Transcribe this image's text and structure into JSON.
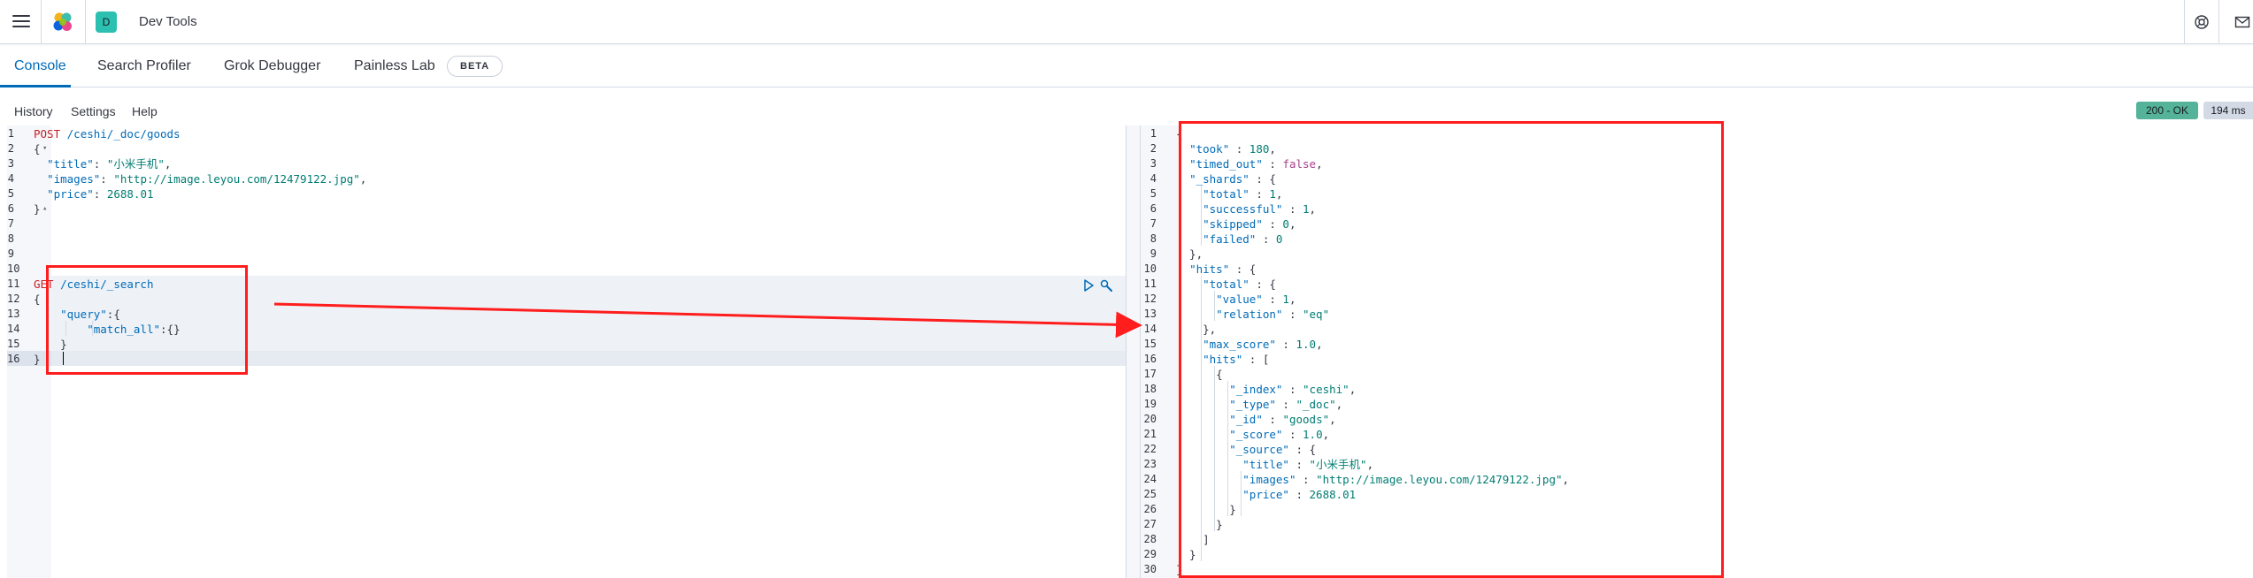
{
  "header": {
    "space_initial": "D",
    "app_title": "Dev Tools"
  },
  "tabs": [
    {
      "label": "Console",
      "active": true
    },
    {
      "label": "Search Profiler",
      "active": false
    },
    {
      "label": "Grok Debugger",
      "active": false
    },
    {
      "label": "Painless Lab",
      "active": false
    }
  ],
  "beta_badge": "BETA",
  "toolbar": {
    "history": "History",
    "settings": "Settings",
    "help": "Help"
  },
  "response_status": "200 - OK",
  "response_time": "194 ms",
  "request_editor": {
    "lines": [
      [
        [
          "m",
          "POST"
        ],
        [
          "",
          " "
        ],
        [
          "u",
          "/ceshi/_doc/goods"
        ]
      ],
      [
        [
          "",
          "{"
        ]
      ],
      [
        [
          "",
          "  "
        ],
        [
          "k",
          "\"title\""
        ],
        [
          "",
          ": "
        ],
        [
          "s",
          "\"小米手机\""
        ],
        [
          "",
          ","
        ]
      ],
      [
        [
          "",
          "  "
        ],
        [
          "k",
          "\"images\""
        ],
        [
          "",
          ": "
        ],
        [
          "s",
          "\"http://image.leyou.com/12479122.jpg\""
        ],
        [
          "",
          ","
        ]
      ],
      [
        [
          "",
          "  "
        ],
        [
          "k",
          "\"price\""
        ],
        [
          "",
          ": "
        ],
        [
          "n",
          "2688.01"
        ]
      ],
      [
        [
          "",
          "}"
        ]
      ],
      [],
      [],
      [],
      [],
      [
        [
          "m",
          "GET"
        ],
        [
          "",
          " "
        ],
        [
          "u",
          "/ceshi/_search"
        ]
      ],
      [
        [
          "",
          "{"
        ]
      ],
      [
        [
          "",
          "    "
        ],
        [
          "k",
          "\"query\""
        ],
        [
          "",
          ":{"
        ]
      ],
      [
        [
          "",
          "        "
        ],
        [
          "k",
          "\"match_all\""
        ],
        [
          "",
          ":{}"
        ]
      ],
      [
        [
          "",
          "    }"
        ]
      ],
      [
        [
          "",
          "}"
        ]
      ]
    ]
  },
  "response_editor": {
    "lines": [
      [
        [
          "",
          "{"
        ]
      ],
      [
        [
          "",
          "  "
        ],
        [
          "k",
          "\"took\""
        ],
        [
          "",
          " : "
        ],
        [
          "n",
          "180"
        ],
        [
          "",
          ","
        ]
      ],
      [
        [
          "",
          "  "
        ],
        [
          "k",
          "\"timed_out\""
        ],
        [
          "",
          " : "
        ],
        [
          "b",
          "false"
        ],
        [
          "",
          ","
        ]
      ],
      [
        [
          "",
          "  "
        ],
        [
          "k",
          "\"_shards\""
        ],
        [
          "",
          " : {"
        ]
      ],
      [
        [
          "",
          "    "
        ],
        [
          "k",
          "\"total\""
        ],
        [
          "",
          " : "
        ],
        [
          "n",
          "1"
        ],
        [
          "",
          ","
        ]
      ],
      [
        [
          "",
          "    "
        ],
        [
          "k",
          "\"successful\""
        ],
        [
          "",
          " : "
        ],
        [
          "n",
          "1"
        ],
        [
          "",
          ","
        ]
      ],
      [
        [
          "",
          "    "
        ],
        [
          "k",
          "\"skipped\""
        ],
        [
          "",
          " : "
        ],
        [
          "n",
          "0"
        ],
        [
          "",
          ","
        ]
      ],
      [
        [
          "",
          "    "
        ],
        [
          "k",
          "\"failed\""
        ],
        [
          "",
          " : "
        ],
        [
          "n",
          "0"
        ]
      ],
      [
        [
          "",
          "  },"
        ]
      ],
      [
        [
          "",
          "  "
        ],
        [
          "k",
          "\"hits\""
        ],
        [
          "",
          " : {"
        ]
      ],
      [
        [
          "",
          "    "
        ],
        [
          "k",
          "\"total\""
        ],
        [
          "",
          " : {"
        ]
      ],
      [
        [
          "",
          "      "
        ],
        [
          "k",
          "\"value\""
        ],
        [
          "",
          " : "
        ],
        [
          "n",
          "1"
        ],
        [
          "",
          ","
        ]
      ],
      [
        [
          "",
          "      "
        ],
        [
          "k",
          "\"relation\""
        ],
        [
          "",
          " : "
        ],
        [
          "s",
          "\"eq\""
        ]
      ],
      [
        [
          "",
          "    },"
        ]
      ],
      [
        [
          "",
          "    "
        ],
        [
          "k",
          "\"max_score\""
        ],
        [
          "",
          " : "
        ],
        [
          "n",
          "1.0"
        ],
        [
          "",
          ","
        ]
      ],
      [
        [
          "",
          "    "
        ],
        [
          "k",
          "\"hits\""
        ],
        [
          "",
          " : ["
        ]
      ],
      [
        [
          "",
          "      {"
        ]
      ],
      [
        [
          "",
          "        "
        ],
        [
          "k",
          "\"_index\""
        ],
        [
          "",
          " : "
        ],
        [
          "s",
          "\"ceshi\""
        ],
        [
          "",
          ","
        ]
      ],
      [
        [
          "",
          "        "
        ],
        [
          "k",
          "\"_type\""
        ],
        [
          "",
          " : "
        ],
        [
          "s",
          "\"_doc\""
        ],
        [
          "",
          ","
        ]
      ],
      [
        [
          "",
          "        "
        ],
        [
          "k",
          "\"_id\""
        ],
        [
          "",
          " : "
        ],
        [
          "s",
          "\"goods\""
        ],
        [
          "",
          ","
        ]
      ],
      [
        [
          "",
          "        "
        ],
        [
          "k",
          "\"_score\""
        ],
        [
          "",
          " : "
        ],
        [
          "n",
          "1.0"
        ],
        [
          "",
          ","
        ]
      ],
      [
        [
          "",
          "        "
        ],
        [
          "k",
          "\"_source\""
        ],
        [
          "",
          " : {"
        ]
      ],
      [
        [
          "",
          "          "
        ],
        [
          "k",
          "\"title\""
        ],
        [
          "",
          " : "
        ],
        [
          "s",
          "\"小米手机\""
        ],
        [
          "",
          ","
        ]
      ],
      [
        [
          "",
          "          "
        ],
        [
          "k",
          "\"images\""
        ],
        [
          "",
          " : "
        ],
        [
          "s",
          "\"http://image.leyou.com/12479122.jpg\""
        ],
        [
          "",
          ","
        ]
      ],
      [
        [
          "",
          "          "
        ],
        [
          "k",
          "\"price\""
        ],
        [
          "",
          " : "
        ],
        [
          "n",
          "2688.01"
        ]
      ],
      [
        [
          "",
          "        }"
        ]
      ],
      [
        [
          "",
          "      }"
        ]
      ],
      [
        [
          "",
          "    ]"
        ]
      ],
      [
        [
          "",
          "  }"
        ]
      ],
      [
        [
          "",
          "}"
        ]
      ]
    ]
  }
}
